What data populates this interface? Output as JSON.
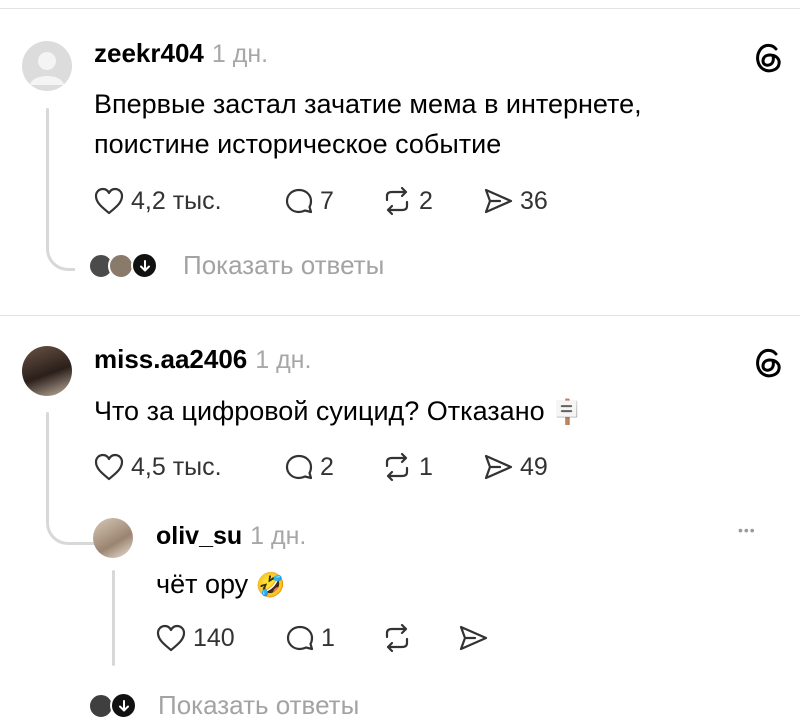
{
  "icons": {
    "like": "heart-icon",
    "reply": "comment-bubble-icon",
    "repost": "repost-icon",
    "share": "share-arrow-icon",
    "app": "threads-logo-icon",
    "expand": "arrow-down-icon",
    "more": "more-dots-icon"
  },
  "colors": {
    "muted": "#a7a7a7",
    "thread_line": "#d8d8d8",
    "text": "#000000"
  },
  "comments": [
    {
      "username": "zeekr404",
      "time": "1 дн.",
      "text_lines": [
        "Впервые застал зачатие мема в интернете,",
        "поистине историческое событие"
      ],
      "stats": {
        "likes": "4,2 тыс.",
        "replies": "7",
        "reposts": "2",
        "shares": "36"
      },
      "show_replies": "Показать ответы"
    },
    {
      "username": "miss.aa2406",
      "time": "1 дн.",
      "text": "Что за цифровой суицид? Отказано",
      "emoji": "🪧",
      "stats": {
        "likes": "4,5 тыс.",
        "replies": "2",
        "reposts": "1",
        "shares": "49"
      },
      "reply": {
        "username": "oliv_su",
        "time": "1 дн.",
        "text": "чёт ору",
        "emoji": "🤣",
        "more": "•••",
        "stats": {
          "likes": "140",
          "replies": "1"
        }
      },
      "show_replies": "Показать ответы"
    }
  ]
}
